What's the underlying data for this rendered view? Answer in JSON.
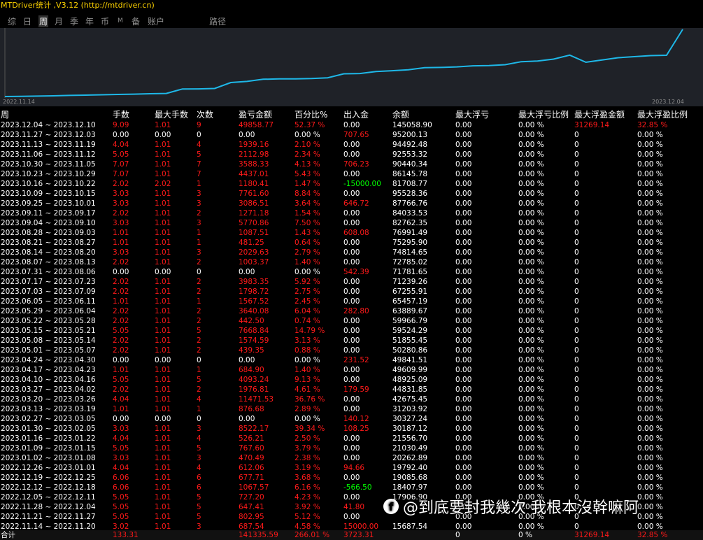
{
  "window": {
    "title": "MTDriver统计 ,V3.12 (http://mtdriver.cn)"
  },
  "tabs": [
    {
      "label": "综"
    },
    {
      "label": "日"
    },
    {
      "label": "周"
    },
    {
      "label": "月"
    },
    {
      "label": "季"
    },
    {
      "label": "年"
    },
    {
      "label": "币"
    },
    {
      "label": "M"
    },
    {
      "label": "备"
    },
    {
      "label": "账户"
    },
    {
      "label": "路径"
    }
  ],
  "active_tab": "周",
  "colors": {
    "line": "#1eb8e8",
    "chart_bg": "#1f2228",
    "loss_red": "#ff1a1a",
    "deposit_green": "#00ff00",
    "title_yellow": "#ffd400"
  },
  "chart_data": {
    "type": "line",
    "x_start_label": "2022.11.14",
    "x_end_label": "2023.12.04",
    "series": [
      {
        "values": [
          15687.54,
          16000,
          16500,
          17000,
          17906.9,
          18407.97,
          19085.68,
          19792.4,
          20262.89,
          21030.49,
          21556.7,
          30187.12,
          30327.24,
          31203.92,
          42675.45,
          44831.85,
          48925.09,
          49609.99,
          49841.51,
          50280.86,
          51855.45,
          59524.29,
          59966.79,
          63889.67,
          65457.19,
          67255.91,
          71239.26,
          71781.65,
          72785.02,
          74814.65,
          75295.9,
          76991.49,
          82762.35,
          84033.53,
          87766.76,
          95528.36,
          81708.77,
          86145.78,
          90440.34,
          92553.32,
          94492.48,
          95200.13,
          145058.9
        ]
      }
    ]
  },
  "table": {
    "headers": [
      "周",
      "手数",
      "最大手数",
      "次数",
      "盈亏金额",
      "百分比%",
      "出入金",
      "余额",
      "最大浮亏",
      "最大浮亏比例",
      "最大浮盈金额",
      "最大浮盈比例"
    ],
    "rows": [
      {
        "week": "2023.12.04 ~ 2023.12.10",
        "lots": "9.09",
        "maxlots": "1.01",
        "count": "9",
        "pnl": "49858.77",
        "pct": "52.37 %",
        "io": "0.00",
        "balance": "145058.90",
        "mdd": "0.00",
        "mddp": "0.00 %",
        "mfe": "31269.14",
        "mfep": "32.85 %",
        "red": true,
        "io_c": "white",
        "mfe_red": true
      },
      {
        "week": "2023.11.27 ~ 2023.12.03",
        "lots": "0.00",
        "maxlots": "0.00",
        "count": "0",
        "pnl": "0.00",
        "pct": "0.00 %",
        "io": "707.65",
        "balance": "95200.13",
        "mdd": "0.00",
        "mddp": "0.00 %",
        "mfe": "0",
        "mfep": "0.00 %",
        "red": false,
        "io_c": "red"
      },
      {
        "week": "2023.11.13 ~ 2023.11.19",
        "lots": "4.04",
        "maxlots": "1.01",
        "count": "4",
        "pnl": "1939.16",
        "pct": "2.10 %",
        "io": "0.00",
        "balance": "94492.48",
        "mdd": "0.00",
        "mddp": "0.00 %",
        "mfe": "0",
        "mfep": "0.00 %",
        "red": true,
        "io_c": "white"
      },
      {
        "week": "2023.11.06 ~ 2023.11.12",
        "lots": "5.05",
        "maxlots": "1.01",
        "count": "5",
        "pnl": "2112.98",
        "pct": "2.34 %",
        "io": "0.00",
        "balance": "92553.32",
        "mdd": "0.00",
        "mddp": "0.00 %",
        "mfe": "0",
        "mfep": "0.00 %",
        "red": true,
        "io_c": "white"
      },
      {
        "week": "2023.10.30 ~ 2023.11.05",
        "lots": "7.07",
        "maxlots": "1.01",
        "count": "7",
        "pnl": "3588.33",
        "pct": "4.13 %",
        "io": "706.23",
        "balance": "90440.34",
        "mdd": "0.00",
        "mddp": "0.00 %",
        "mfe": "0",
        "mfep": "0.00 %",
        "red": true,
        "io_c": "red"
      },
      {
        "week": "2023.10.23 ~ 2023.10.29",
        "lots": "7.07",
        "maxlots": "1.01",
        "count": "7",
        "pnl": "4437.01",
        "pct": "5.43 %",
        "io": "0.00",
        "balance": "86145.78",
        "mdd": "0.00",
        "mddp": "0.00 %",
        "mfe": "0",
        "mfep": "0.00 %",
        "red": true,
        "io_c": "white"
      },
      {
        "week": "2023.10.16 ~ 2023.10.22",
        "lots": "2.02",
        "maxlots": "2.02",
        "count": "1",
        "pnl": "1180.41",
        "pct": "1.47 %",
        "io": "-15000.00",
        "balance": "81708.77",
        "mdd": "0.00",
        "mddp": "0.00 %",
        "mfe": "0",
        "mfep": "0.00 %",
        "red": true,
        "io_c": "green"
      },
      {
        "week": "2023.10.09 ~ 2023.10.15",
        "lots": "3.03",
        "maxlots": "1.01",
        "count": "3",
        "pnl": "7761.60",
        "pct": "8.84 %",
        "io": "0.00",
        "balance": "95528.36",
        "mdd": "0.00",
        "mddp": "0.00 %",
        "mfe": "0",
        "mfep": "0.00 %",
        "red": true,
        "io_c": "white"
      },
      {
        "week": "2023.09.25 ~ 2023.10.01",
        "lots": "3.03",
        "maxlots": "1.01",
        "count": "3",
        "pnl": "3086.51",
        "pct": "3.64 %",
        "io": "646.72",
        "balance": "87766.76",
        "mdd": "0.00",
        "mddp": "0.00 %",
        "mfe": "0",
        "mfep": "0.00 %",
        "red": true,
        "io_c": "red"
      },
      {
        "week": "2023.09.11 ~ 2023.09.17",
        "lots": "2.02",
        "maxlots": "1.01",
        "count": "2",
        "pnl": "1271.18",
        "pct": "1.54 %",
        "io": "0.00",
        "balance": "84033.53",
        "mdd": "0.00",
        "mddp": "0.00 %",
        "mfe": "0",
        "mfep": "0.00 %",
        "red": true,
        "io_c": "white"
      },
      {
        "week": "2023.09.04 ~ 2023.09.10",
        "lots": "3.03",
        "maxlots": "1.01",
        "count": "3",
        "pnl": "5770.86",
        "pct": "7.50 %",
        "io": "0.00",
        "balance": "82762.35",
        "mdd": "0.00",
        "mddp": "0.00 %",
        "mfe": "0",
        "mfep": "0.00 %",
        "red": true,
        "io_c": "white"
      },
      {
        "week": "2023.08.28 ~ 2023.09.03",
        "lots": "1.01",
        "maxlots": "1.01",
        "count": "1",
        "pnl": "1087.51",
        "pct": "1.43 %",
        "io": "608.08",
        "balance": "76991.49",
        "mdd": "0.00",
        "mddp": "0.00 %",
        "mfe": "0",
        "mfep": "0.00 %",
        "red": true,
        "io_c": "red"
      },
      {
        "week": "2023.08.21 ~ 2023.08.27",
        "lots": "1.01",
        "maxlots": "1.01",
        "count": "1",
        "pnl": "481.25",
        "pct": "0.64 %",
        "io": "0.00",
        "balance": "75295.90",
        "mdd": "0.00",
        "mddp": "0.00 %",
        "mfe": "0",
        "mfep": "0.00 %",
        "red": true,
        "io_c": "white"
      },
      {
        "week": "2023.08.14 ~ 2023.08.20",
        "lots": "3.03",
        "maxlots": "1.01",
        "count": "3",
        "pnl": "2029.63",
        "pct": "2.79 %",
        "io": "0.00",
        "balance": "74814.65",
        "mdd": "0.00",
        "mddp": "0.00 %",
        "mfe": "0",
        "mfep": "0.00 %",
        "red": true,
        "io_c": "white"
      },
      {
        "week": "2023.08.07 ~ 2023.08.13",
        "lots": "2.02",
        "maxlots": "1.01",
        "count": "2",
        "pnl": "1003.37",
        "pct": "1.40 %",
        "io": "0.00",
        "balance": "72785.02",
        "mdd": "0.00",
        "mddp": "0.00 %",
        "mfe": "0",
        "mfep": "0.00 %",
        "red": true,
        "io_c": "white"
      },
      {
        "week": "2023.07.31 ~ 2023.08.06",
        "lots": "0.00",
        "maxlots": "0.00",
        "count": "0",
        "pnl": "0.00",
        "pct": "0.00 %",
        "io": "542.39",
        "balance": "71781.65",
        "mdd": "0.00",
        "mddp": "0.00 %",
        "mfe": "0",
        "mfep": "0.00 %",
        "red": false,
        "io_c": "red"
      },
      {
        "week": "2023.07.17 ~ 2023.07.23",
        "lots": "2.02",
        "maxlots": "1.01",
        "count": "2",
        "pnl": "3983.35",
        "pct": "5.92 %",
        "io": "0.00",
        "balance": "71239.26",
        "mdd": "0.00",
        "mddp": "0.00 %",
        "mfe": "0",
        "mfep": "0.00 %",
        "red": true,
        "io_c": "white"
      },
      {
        "week": "2023.07.03 ~ 2023.07.09",
        "lots": "2.02",
        "maxlots": "1.01",
        "count": "2",
        "pnl": "1798.72",
        "pct": "2.75 %",
        "io": "0.00",
        "balance": "67255.91",
        "mdd": "0.00",
        "mddp": "0.00 %",
        "mfe": "0",
        "mfep": "0.00 %",
        "red": true,
        "io_c": "white"
      },
      {
        "week": "2023.06.05 ~ 2023.06.11",
        "lots": "1.01",
        "maxlots": "1.01",
        "count": "1",
        "pnl": "1567.52",
        "pct": "2.45 %",
        "io": "0.00",
        "balance": "65457.19",
        "mdd": "0.00",
        "mddp": "0.00 %",
        "mfe": "0",
        "mfep": "0.00 %",
        "red": true,
        "io_c": "white"
      },
      {
        "week": "2023.05.29 ~ 2023.06.04",
        "lots": "2.02",
        "maxlots": "1.01",
        "count": "2",
        "pnl": "3640.08",
        "pct": "6.04 %",
        "io": "282.80",
        "balance": "63889.67",
        "mdd": "0.00",
        "mddp": "0.00 %",
        "mfe": "0",
        "mfep": "0.00 %",
        "red": true,
        "io_c": "red"
      },
      {
        "week": "2023.05.22 ~ 2023.05.28",
        "lots": "2.02",
        "maxlots": "1.01",
        "count": "2",
        "pnl": "442.50",
        "pct": "0.74 %",
        "io": "0.00",
        "balance": "59966.79",
        "mdd": "0.00",
        "mddp": "0.00 %",
        "mfe": "0",
        "mfep": "0.00 %",
        "red": true,
        "io_c": "white"
      },
      {
        "week": "2023.05.15 ~ 2023.05.21",
        "lots": "5.05",
        "maxlots": "1.01",
        "count": "5",
        "pnl": "7668.84",
        "pct": "14.79 %",
        "io": "0.00",
        "balance": "59524.29",
        "mdd": "0.00",
        "mddp": "0.00 %",
        "mfe": "0",
        "mfep": "0.00 %",
        "red": true,
        "io_c": "white"
      },
      {
        "week": "2023.05.08 ~ 2023.05.14",
        "lots": "2.02",
        "maxlots": "1.01",
        "count": "2",
        "pnl": "1574.59",
        "pct": "3.13 %",
        "io": "0.00",
        "balance": "51855.45",
        "mdd": "0.00",
        "mddp": "0.00 %",
        "mfe": "0",
        "mfep": "0.00 %",
        "red": true,
        "io_c": "white"
      },
      {
        "week": "2023.05.01 ~ 2023.05.07",
        "lots": "2.02",
        "maxlots": "1.01",
        "count": "2",
        "pnl": "439.35",
        "pct": "0.88 %",
        "io": "0.00",
        "balance": "50280.86",
        "mdd": "0.00",
        "mddp": "0.00 %",
        "mfe": "0",
        "mfep": "0.00 %",
        "red": true,
        "io_c": "white"
      },
      {
        "week": "2023.04.24 ~ 2023.04.30",
        "lots": "0.00",
        "maxlots": "0.00",
        "count": "0",
        "pnl": "0.00",
        "pct": "0.00 %",
        "io": "231.52",
        "balance": "49841.51",
        "mdd": "0.00",
        "mddp": "0.00 %",
        "mfe": "0",
        "mfep": "0.00 %",
        "red": false,
        "io_c": "red"
      },
      {
        "week": "2023.04.17 ~ 2023.04.23",
        "lots": "1.01",
        "maxlots": "1.01",
        "count": "1",
        "pnl": "684.90",
        "pct": "1.40 %",
        "io": "0.00",
        "balance": "49609.99",
        "mdd": "0.00",
        "mddp": "0.00 %",
        "mfe": "0",
        "mfep": "0.00 %",
        "red": true,
        "io_c": "white"
      },
      {
        "week": "2023.04.10 ~ 2023.04.16",
        "lots": "5.05",
        "maxlots": "1.01",
        "count": "5",
        "pnl": "4093.24",
        "pct": "9.13 %",
        "io": "0.00",
        "balance": "48925.09",
        "mdd": "0.00",
        "mddp": "0.00 %",
        "mfe": "0",
        "mfep": "0.00 %",
        "red": true,
        "io_c": "white"
      },
      {
        "week": "2023.03.27 ~ 2023.04.02",
        "lots": "2.02",
        "maxlots": "1.01",
        "count": "2",
        "pnl": "1976.81",
        "pct": "4.61 %",
        "io": "179.59",
        "balance": "44831.85",
        "mdd": "0.00",
        "mddp": "0.00 %",
        "mfe": "0",
        "mfep": "0.00 %",
        "red": true,
        "io_c": "red"
      },
      {
        "week": "2023.03.20 ~ 2023.03.26",
        "lots": "4.04",
        "maxlots": "1.01",
        "count": "4",
        "pnl": "11471.53",
        "pct": "36.76 %",
        "io": "0.00",
        "balance": "42675.45",
        "mdd": "0.00",
        "mddp": "0.00 %",
        "mfe": "0",
        "mfep": "0.00 %",
        "red": true,
        "io_c": "white"
      },
      {
        "week": "2023.03.13 ~ 2023.03.19",
        "lots": "1.01",
        "maxlots": "1.01",
        "count": "1",
        "pnl": "876.68",
        "pct": "2.89 %",
        "io": "0.00",
        "balance": "31203.92",
        "mdd": "0.00",
        "mddp": "0.00 %",
        "mfe": "0",
        "mfep": "0.00 %",
        "red": true,
        "io_c": "white"
      },
      {
        "week": "2023.02.27 ~ 2023.03.05",
        "lots": "0.00",
        "maxlots": "0.00",
        "count": "0",
        "pnl": "0.00",
        "pct": "0.00 %",
        "io": "140.12",
        "balance": "30327.24",
        "mdd": "0.00",
        "mddp": "0.00 %",
        "mfe": "0",
        "mfep": "0.00 %",
        "red": false,
        "io_c": "red"
      },
      {
        "week": "2023.01.30 ~ 2023.02.05",
        "lots": "3.03",
        "maxlots": "1.01",
        "count": "3",
        "pnl": "8522.17",
        "pct": "39.34 %",
        "io": "108.25",
        "balance": "30187.12",
        "mdd": "0.00",
        "mddp": "0.00 %",
        "mfe": "0",
        "mfep": "0.00 %",
        "red": true,
        "io_c": "red"
      },
      {
        "week": "2023.01.16 ~ 2023.01.22",
        "lots": "4.04",
        "maxlots": "1.01",
        "count": "4",
        "pnl": "526.21",
        "pct": "2.50 %",
        "io": "0.00",
        "balance": "21556.70",
        "mdd": "0.00",
        "mddp": "0.00 %",
        "mfe": "0",
        "mfep": "0.00 %",
        "red": true,
        "io_c": "white"
      },
      {
        "week": "2023.01.09 ~ 2023.01.15",
        "lots": "5.05",
        "maxlots": "1.01",
        "count": "5",
        "pnl": "767.60",
        "pct": "3.79 %",
        "io": "0.00",
        "balance": "21030.49",
        "mdd": "0.00",
        "mddp": "0.00 %",
        "mfe": "0",
        "mfep": "0.00 %",
        "red": true,
        "io_c": "white"
      },
      {
        "week": "2023.01.02 ~ 2023.01.08",
        "lots": "3.03",
        "maxlots": "1.01",
        "count": "3",
        "pnl": "470.49",
        "pct": "2.38 %",
        "io": "0.00",
        "balance": "20262.89",
        "mdd": "0.00",
        "mddp": "0.00 %",
        "mfe": "0",
        "mfep": "0.00 %",
        "red": true,
        "io_c": "white"
      },
      {
        "week": "2022.12.26 ~ 2023.01.01",
        "lots": "4.04",
        "maxlots": "1.01",
        "count": "4",
        "pnl": "612.06",
        "pct": "3.19 %",
        "io": "94.66",
        "balance": "19792.40",
        "mdd": "0.00",
        "mddp": "0.00 %",
        "mfe": "0",
        "mfep": "0.00 %",
        "red": true,
        "io_c": "red"
      },
      {
        "week": "2022.12.19 ~ 2022.12.25",
        "lots": "6.06",
        "maxlots": "1.01",
        "count": "6",
        "pnl": "677.71",
        "pct": "3.68 %",
        "io": "0.00",
        "balance": "19085.68",
        "mdd": "0.00",
        "mddp": "0.00 %",
        "mfe": "0",
        "mfep": "0.00 %",
        "red": true,
        "io_c": "white"
      },
      {
        "week": "2022.12.12 ~ 2022.12.18",
        "lots": "6.06",
        "maxlots": "1.01",
        "count": "6",
        "pnl": "1067.57",
        "pct": "6.16 %",
        "io": "-566.50",
        "balance": "18407.97",
        "mdd": "0.00",
        "mddp": "0.00 %",
        "mfe": "0",
        "mfep": "0.00 %",
        "red": true,
        "io_c": "green"
      },
      {
        "week": "2022.12.05 ~ 2022.12.11",
        "lots": "5.05",
        "maxlots": "1.01",
        "count": "5",
        "pnl": "727.20",
        "pct": "4.23 %",
        "io": "0.00",
        "balance": "17906.90",
        "mdd": "0.00",
        "mddp": "0.00 %",
        "mfe": "0",
        "mfep": "0.00 %",
        "red": true,
        "io_c": "white"
      },
      {
        "week": "2022.11.28 ~ 2022.12.04",
        "lots": "5.05",
        "maxlots": "1.01",
        "count": "5",
        "pnl": "647.41",
        "pct": "3.92 %",
        "io": "41.80",
        "balance": "",
        "mdd": "0.00",
        "mddp": "0.00 %",
        "mfe": "0",
        "mfep": "0.00 %",
        "red": true,
        "io_c": "red"
      },
      {
        "week": "2022.11.21 ~ 2022.11.27",
        "lots": "5.05",
        "maxlots": "1.01",
        "count": "5",
        "pnl": "802.95",
        "pct": "5.12 %",
        "io": "0.00",
        "balance": "",
        "mdd": "0.00",
        "mddp": "0.00 %",
        "mfe": "0",
        "mfep": "0.00 %",
        "red": true,
        "io_c": "white"
      },
      {
        "week": "2022.11.14 ~ 2022.11.20",
        "lots": "3.02",
        "maxlots": "1.01",
        "count": "3",
        "pnl": "687.54",
        "pct": "4.58 %",
        "io": "15000.00",
        "balance": "15687.54",
        "mdd": "0.00",
        "mddp": "0.00 %",
        "mfe": "0",
        "mfep": "0.00 %",
        "red": true,
        "io_c": "red"
      }
    ],
    "footer": {
      "week": "合计",
      "lots": "133.31",
      "pnl": "141335.59",
      "pct": "266.01 %",
      "io": "3723.31",
      "mdd": "0",
      "mddp": "0 %",
      "mfe": "31269.14",
      "mfep": "32.85 %"
    }
  },
  "watermark": {
    "logo": "f",
    "text": "@到底要封我幾次 我根本沒幹嘛阿"
  }
}
